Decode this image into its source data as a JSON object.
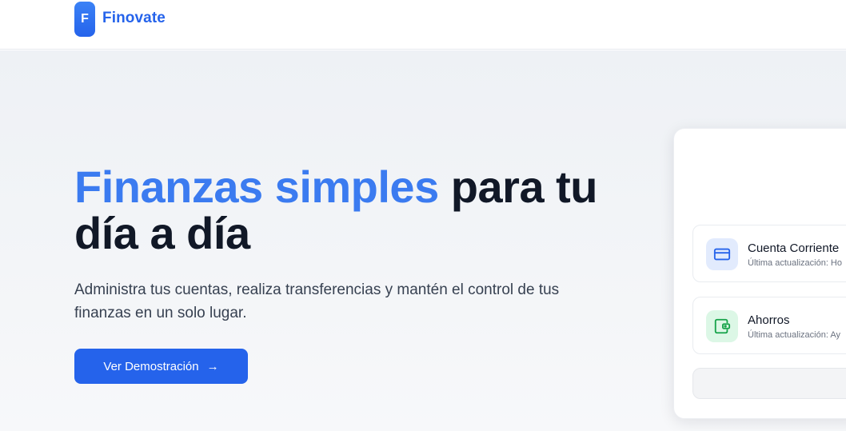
{
  "brand": {
    "logo_letter": "F",
    "name": "Finovate"
  },
  "hero": {
    "headline_accent": "Finanzas simples",
    "headline_rest": "para tu día a día",
    "subtitle": "Administra tus cuentas, realiza transferencias y mantén el control de tus finanzas en un solo lugar.",
    "cta_label": "Ver Demostración",
    "cta_arrow": "→"
  },
  "accounts": [
    {
      "name": "Cuenta Corriente",
      "meta": "Última actualización: Ho",
      "icon": "credit-card-icon",
      "color": "#2563eb",
      "bg": "#e2ebfd"
    },
    {
      "name": "Ahorros",
      "meta": "Última actualización: Ay",
      "icon": "wallet-icon",
      "color": "#16a34a",
      "bg": "#dcf7e6"
    }
  ]
}
